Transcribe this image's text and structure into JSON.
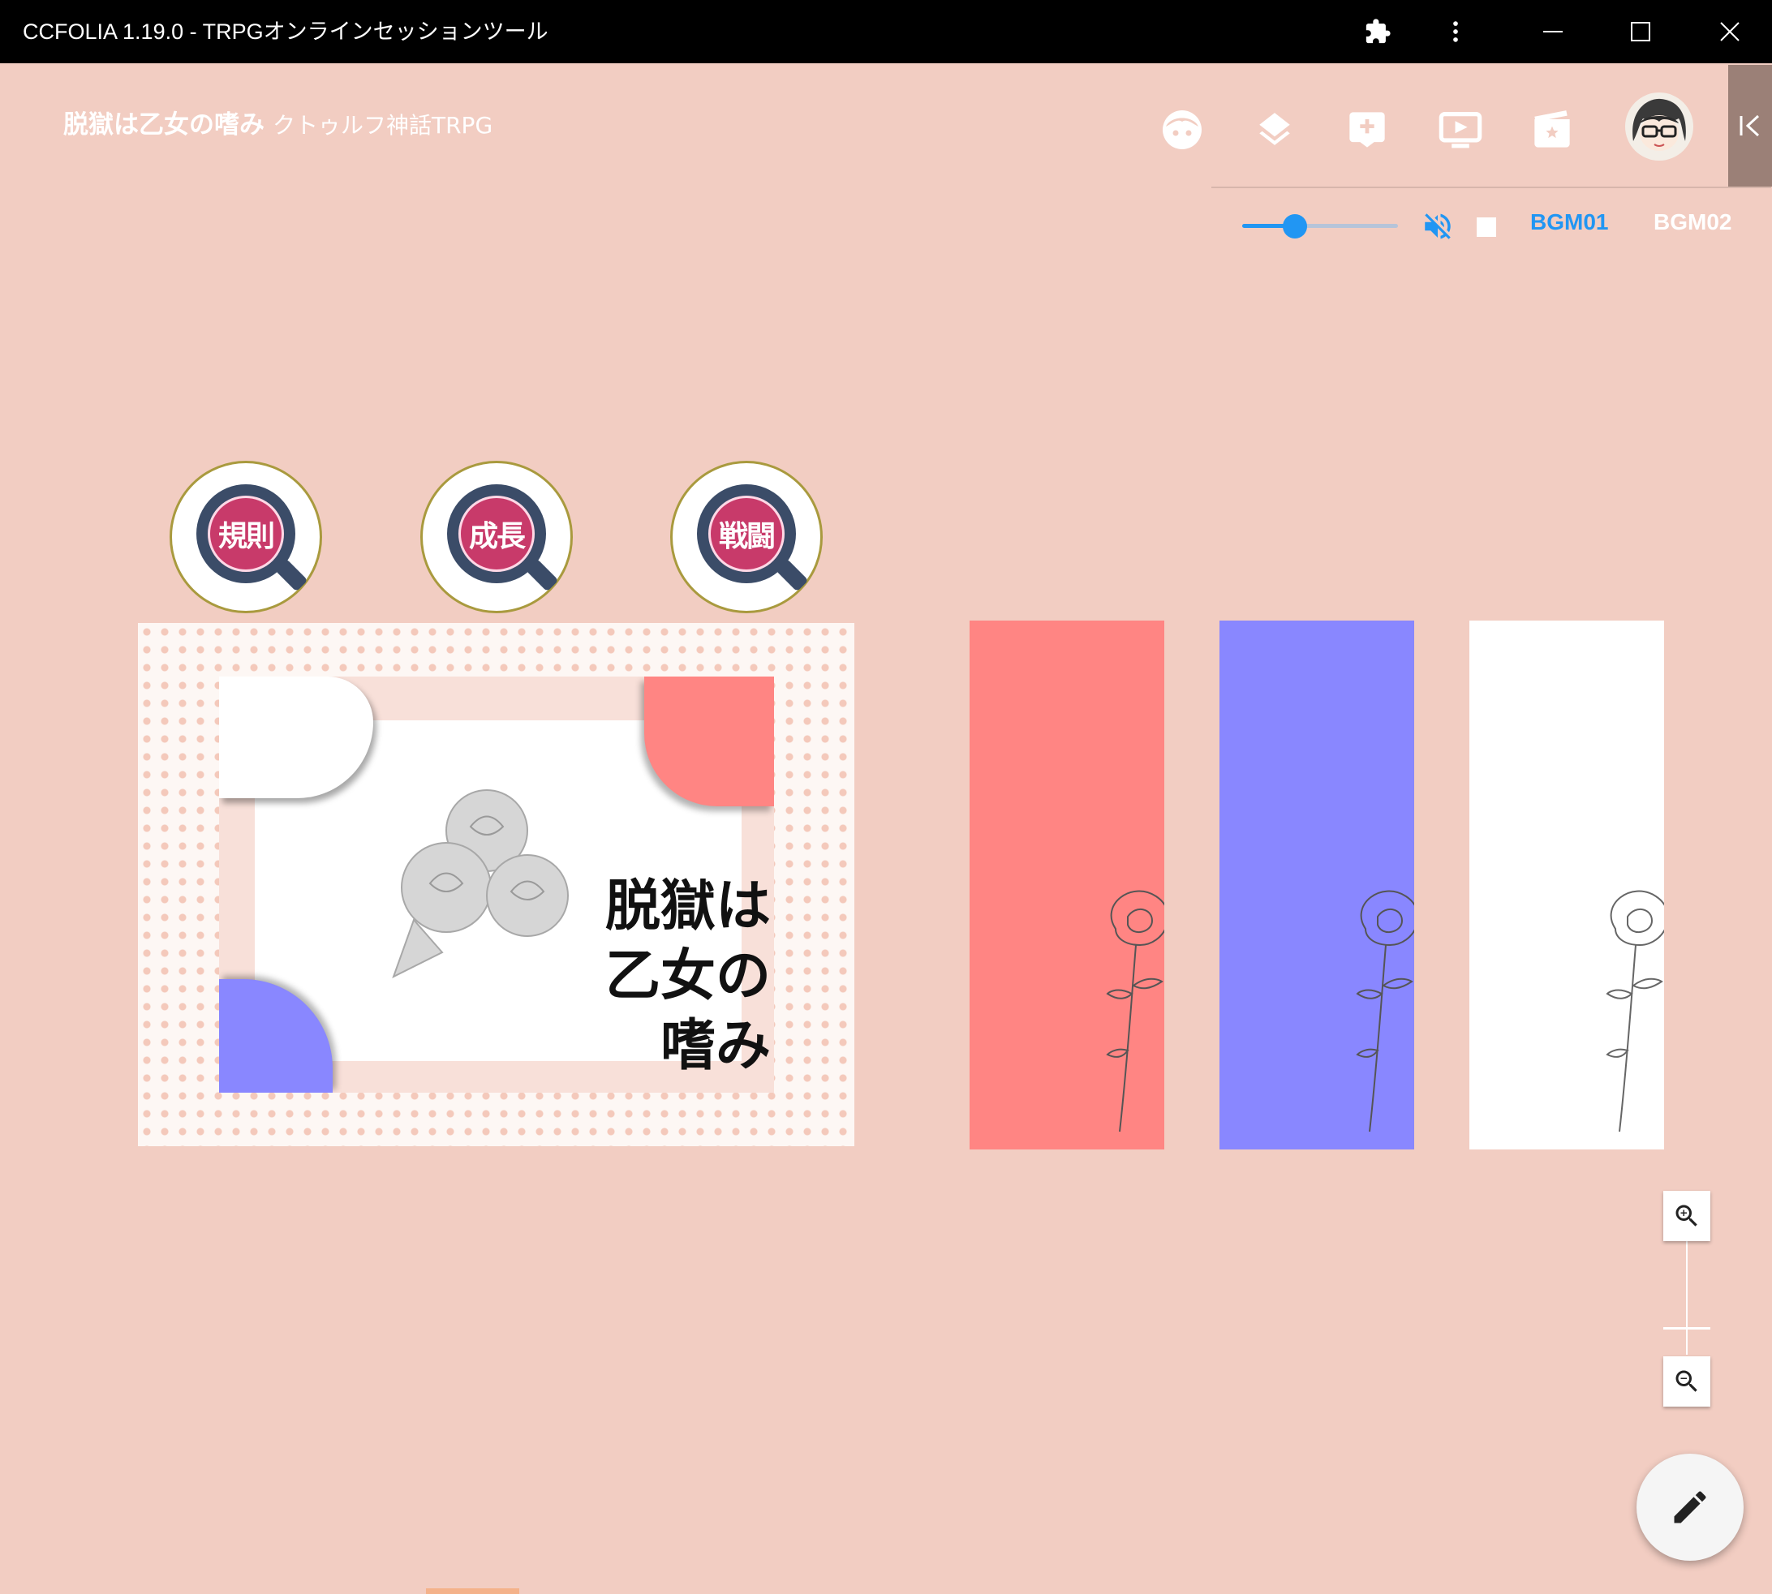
{
  "window": {
    "title": "CCFOLIA 1.19.0 - TRPGオンラインセッションツール"
  },
  "room": {
    "name": "脱獄は乙女の嗜み",
    "system": "クトゥルフ神話TRPG"
  },
  "audio": {
    "volume_percent": 35,
    "muted": true,
    "tracks": [
      {
        "label": "BGM01",
        "active": true
      },
      {
        "label": "BGM02",
        "active": false
      }
    ]
  },
  "board": {
    "circle_buttons": [
      {
        "label": "規則"
      },
      {
        "label": "成長"
      },
      {
        "label": "戦闘"
      }
    ],
    "title_art": {
      "line1": "脱獄は",
      "line2": "乙女の",
      "line3": "嗜み"
    },
    "cards": [
      {
        "color": "#ff8583"
      },
      {
        "color": "#8987ff"
      },
      {
        "color": "#ffffff"
      }
    ]
  },
  "colors": {
    "background": "#f2cdc2",
    "accent": "#2196f3",
    "titlebar": "#000000"
  },
  "icons": {
    "titlebar": [
      "extension-icon",
      "more-vert-icon",
      "minimize-icon",
      "maximize-icon",
      "close-icon"
    ],
    "appbar": [
      "face-icon",
      "layers-icon",
      "add-comment-icon",
      "screen-share-icon",
      "scene-icon"
    ],
    "zoom": [
      "zoom-in-icon",
      "zoom-out-icon"
    ],
    "fab": "edit-icon"
  }
}
